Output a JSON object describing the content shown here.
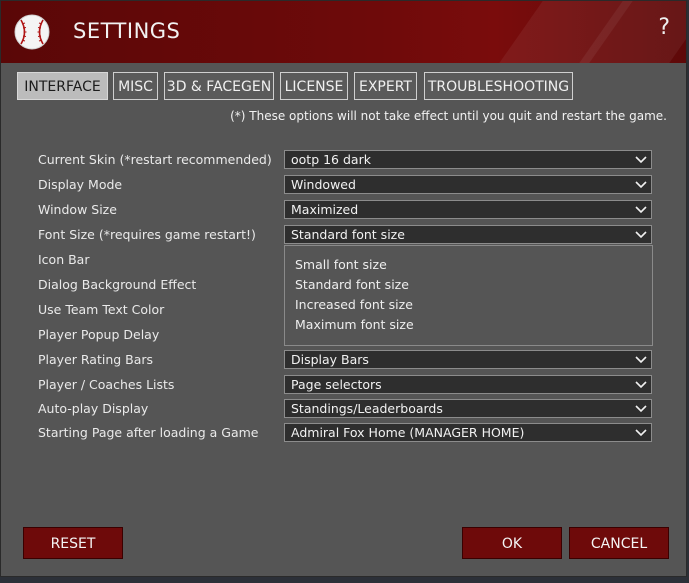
{
  "header": {
    "title": "SETTINGS",
    "help_label": "?"
  },
  "tabs": [
    {
      "label": "INTERFACE",
      "active": true
    },
    {
      "label": "MISC"
    },
    {
      "label": "3D & FACEGEN"
    },
    {
      "label": "LICENSE"
    },
    {
      "label": "EXPERT"
    },
    {
      "label": "TROUBLESHOOTING"
    }
  ],
  "notice": "(*) These options will not take effect until you quit and restart the game.",
  "settings": [
    {
      "label": "Current Skin (*restart recommended)",
      "value": "ootp 16 dark"
    },
    {
      "label": "Display Mode",
      "value": "Windowed"
    },
    {
      "label": "Window Size",
      "value": "Maximized"
    },
    {
      "label": "Font Size (*requires game restart!)",
      "value": "Standard font size"
    },
    {
      "label": "Icon Bar"
    },
    {
      "label": "Dialog Background Effect"
    },
    {
      "label": "Use Team Text Color"
    },
    {
      "label": "Player Popup Delay"
    },
    {
      "label": "Player Rating Bars",
      "value": "Display Bars"
    },
    {
      "label": "Player / Coaches Lists",
      "value": "Page selectors"
    },
    {
      "label": "Auto-play Display",
      "value": "Standings/Leaderboards"
    },
    {
      "label": "Starting Page after loading a Game",
      "value": "Admiral Fox Home (MANAGER HOME)"
    }
  ],
  "font_size_options": [
    "Small font size",
    "Standard font size",
    "Increased font size",
    "Maximum font size"
  ],
  "buttons": {
    "reset": "RESET",
    "ok": "OK",
    "cancel": "CANCEL"
  },
  "colors": {
    "header": "#6e0a0a",
    "button": "#6e0a0a",
    "panel": "#555555",
    "active_tab": "#bcbcbc"
  },
  "icons": {
    "logo": "baseball-icon",
    "dropdown": "chevron-down-icon"
  }
}
